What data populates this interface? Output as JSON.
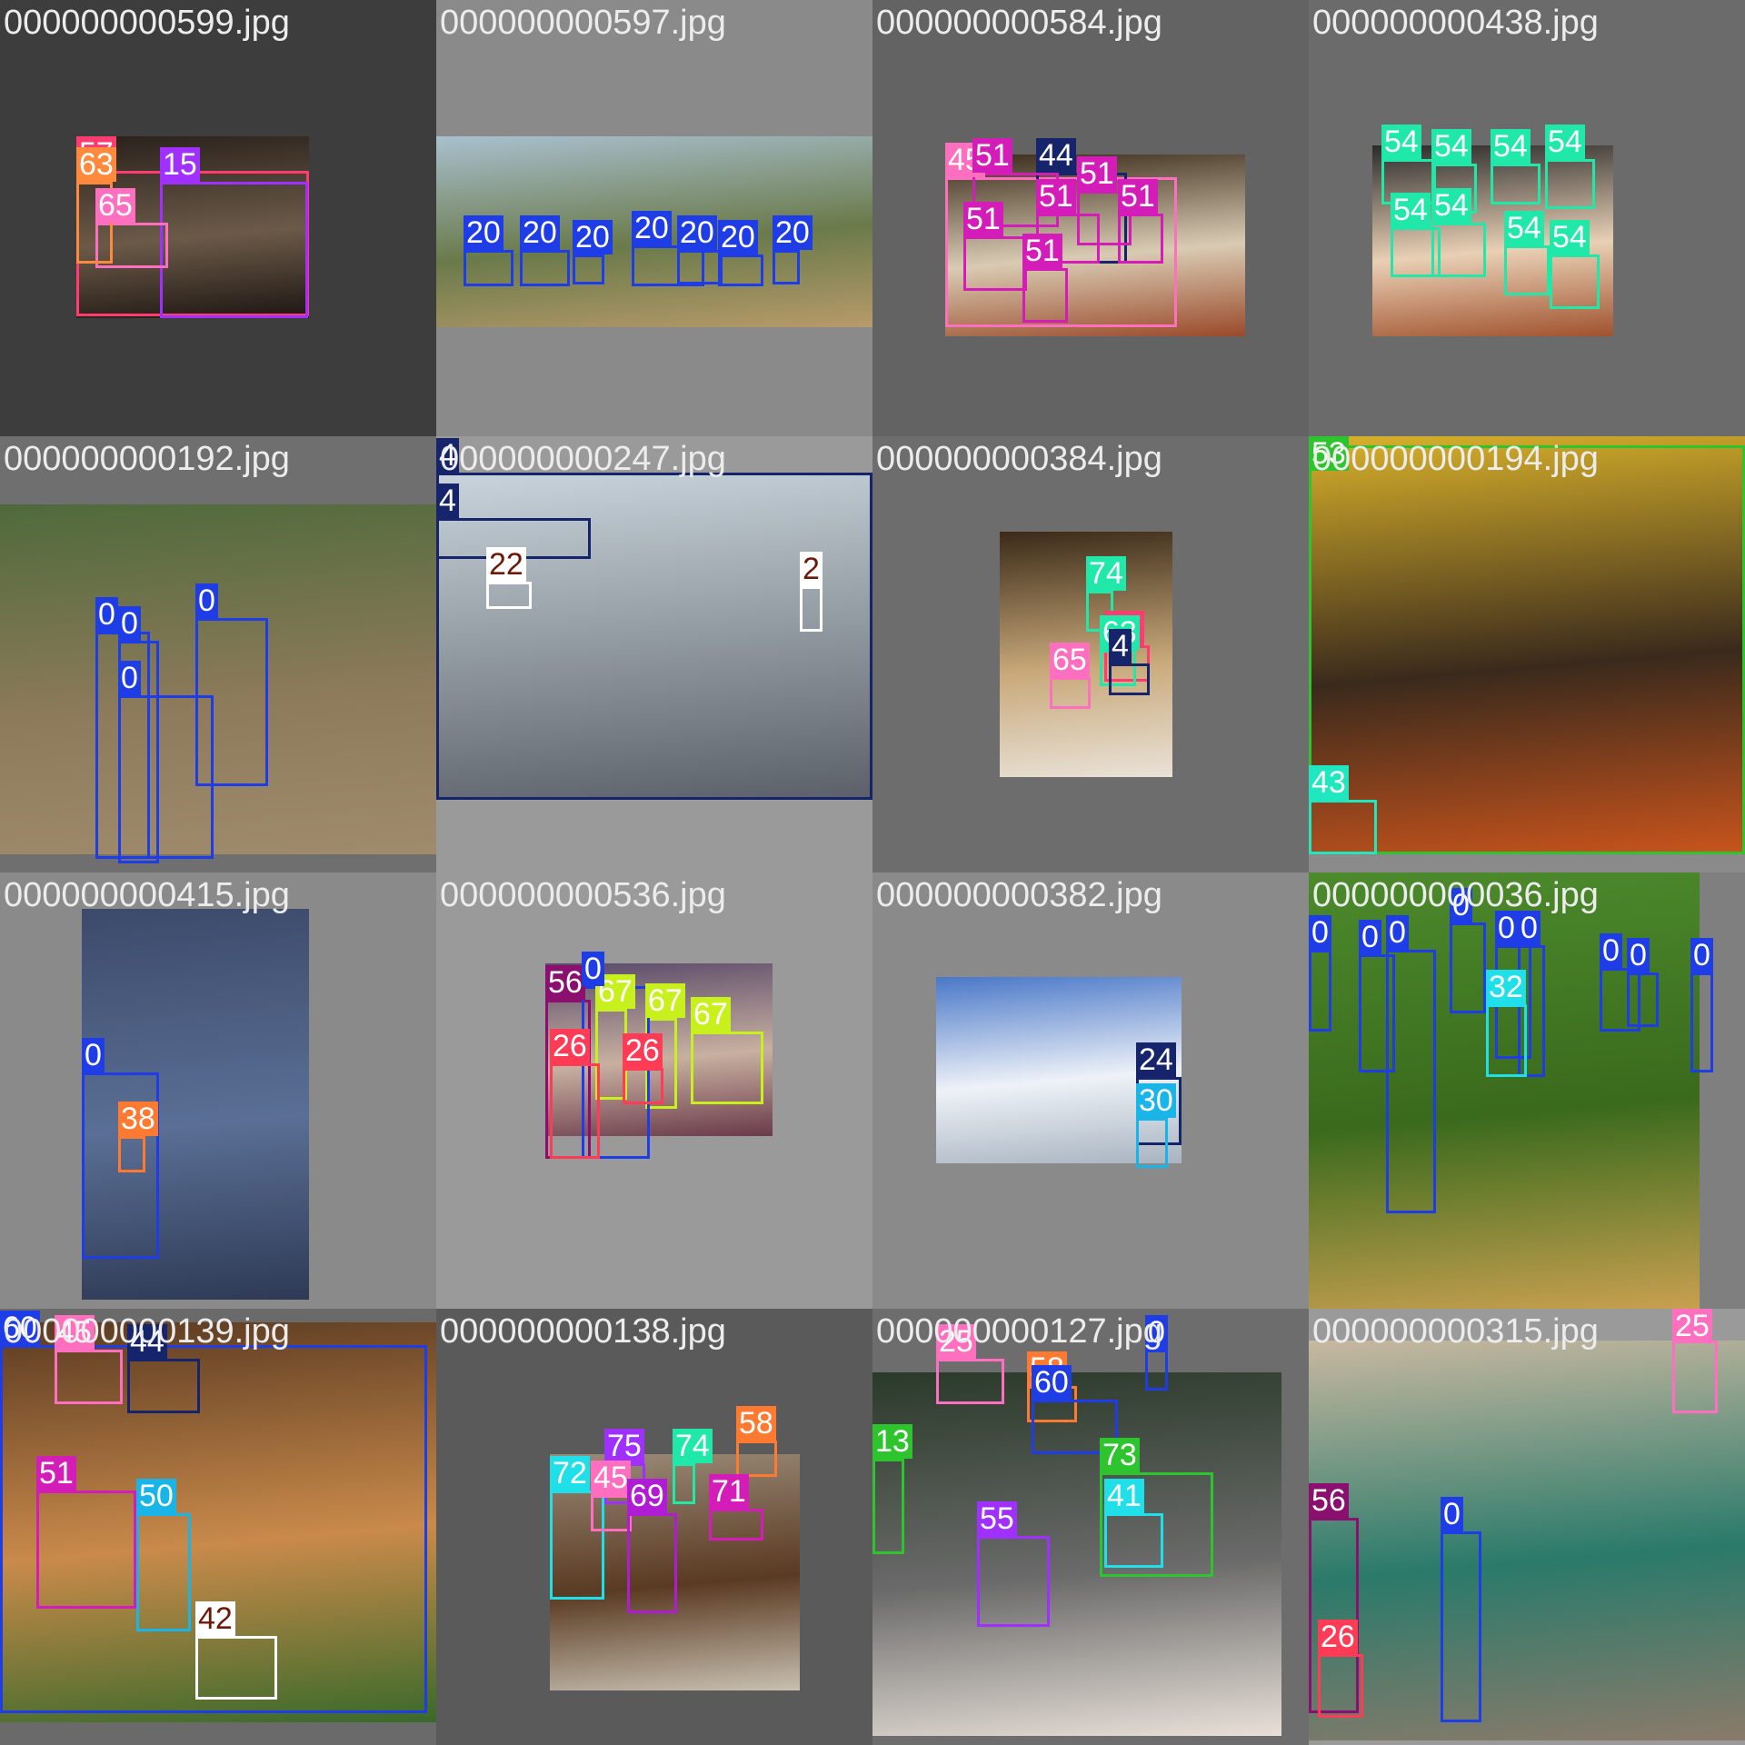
{
  "tiles": [
    {
      "filename": "000000000599.jpg",
      "background": "#3d3d3d",
      "photo_colors": [
        "#2a211c",
        "#6b5a48",
        "#1e1612"
      ],
      "detections": [
        {
          "label": "57",
          "color": "#ff3b70"
        },
        {
          "label": "15",
          "color": "#9f30ff"
        },
        {
          "label": "65",
          "color": "#ff6fbf"
        },
        {
          "label": "63",
          "color": "#ff8a3d"
        }
      ]
    },
    {
      "filename": "000000000597.jpg",
      "background": "#8a8a8a",
      "photo_colors": [
        "#a9c0cf",
        "#6a7a4a",
        "#b89a6a"
      ],
      "detections": [
        {
          "label": "20",
          "color": "#1f3de6"
        },
        {
          "label": "20",
          "color": "#1f3de6"
        },
        {
          "label": "20",
          "color": "#1f3de6"
        },
        {
          "label": "20",
          "color": "#1f3de6"
        },
        {
          "label": "20",
          "color": "#1f3de6"
        },
        {
          "label": "20",
          "color": "#1f3de6"
        },
        {
          "label": "20",
          "color": "#1f3de6"
        }
      ]
    },
    {
      "filename": "000000000584.jpg",
      "background": "#636363",
      "photo_colors": [
        "#3a2a1a",
        "#d9cbb3",
        "#9a4a2a"
      ],
      "detections": [
        {
          "label": "45",
          "color": "#ff6fbf"
        },
        {
          "label": "44",
          "color": "#16246b"
        },
        {
          "label": "51",
          "color": "#d41cb8"
        },
        {
          "label": "51",
          "color": "#d41cb8"
        },
        {
          "label": "51",
          "color": "#d41cb8"
        },
        {
          "label": "51",
          "color": "#d41cb8"
        },
        {
          "label": "51",
          "color": "#d41cb8"
        },
        {
          "label": "51",
          "color": "#d41cb8"
        }
      ]
    },
    {
      "filename": "000000000438.jpg",
      "background": "#6b6b6b",
      "photo_colors": [
        "#2b2b2b",
        "#e9d0b5",
        "#a0522d"
      ],
      "detections": [
        {
          "label": "54",
          "color": "#1fe8a8"
        },
        {
          "label": "54",
          "color": "#1fe8a8"
        },
        {
          "label": "54",
          "color": "#1fe8a8"
        },
        {
          "label": "54",
          "color": "#1fe8a8"
        },
        {
          "label": "54",
          "color": "#1fe8a8"
        },
        {
          "label": "54",
          "color": "#1fe8a8"
        },
        {
          "label": "54",
          "color": "#1fe8a8"
        },
        {
          "label": "54",
          "color": "#1fe8a8"
        }
      ]
    },
    {
      "filename": "000000000192.jpg",
      "background": "#6f6f6f",
      "photo_colors": [
        "#4f6a3c",
        "#8c7a5a",
        "#a08c6c"
      ],
      "detections": [
        {
          "label": "0",
          "color": "#1f3de6"
        },
        {
          "label": "0",
          "color": "#1f3de6"
        },
        {
          "label": "0",
          "color": "#1f3de6"
        },
        {
          "label": "0",
          "color": "#1f3de6"
        }
      ]
    },
    {
      "filename": "000000000247.jpg",
      "background": "#9a9a9a",
      "photo_colors": [
        "#c9d4dc",
        "#8d959c",
        "#5b6068"
      ],
      "detections": [
        {
          "label": "4",
          "color": "#16246b"
        },
        {
          "label": "4",
          "color": "#16246b"
        },
        {
          "label": "22",
          "color": "#ffffff",
          "text_color": "#6b1a0a"
        },
        {
          "label": "2",
          "color": "#ffffff",
          "text_color": "#6b1a0a"
        }
      ]
    },
    {
      "filename": "000000000384.jpg",
      "background": "#6d6d6d",
      "photo_colors": [
        "#3a2a18",
        "#c9a97a",
        "#e9e2d8"
      ],
      "detections": [
        {
          "label": "74",
          "color": "#1fe8a8"
        },
        {
          "label": "57",
          "color": "#ff3b70"
        },
        {
          "label": "63",
          "color": "#1fe8a8"
        },
        {
          "label": "65",
          "color": "#ff6fbf"
        },
        {
          "label": "4",
          "color": "#16246b"
        }
      ]
    },
    {
      "filename": "000000000194.jpg",
      "background": "#8a8a8a",
      "photo_colors": [
        "#d9b22a",
        "#3a2a1c",
        "#c9541c"
      ],
      "detections": [
        {
          "label": "53",
          "color": "#2ec42e"
        },
        {
          "label": "43",
          "color": "#1fe8c0"
        }
      ]
    },
    {
      "filename": "000000000415.jpg",
      "background": "#8a8a8a",
      "photo_colors": [
        "#3c4a6a",
        "#5a6f95",
        "#2e3a55"
      ],
      "detections": [
        {
          "label": "0",
          "color": "#1f3de6"
        },
        {
          "label": "38",
          "color": "#ff7a30"
        }
      ]
    },
    {
      "filename": "000000000536.jpg",
      "background": "#9a9a9a",
      "photo_colors": [
        "#5a4a6a",
        "#c8b0a0",
        "#6a3a4a"
      ],
      "detections": [
        {
          "label": "56",
          "color": "#8b0f6e"
        },
        {
          "label": "67",
          "color": "#c8f01c"
        },
        {
          "label": "67",
          "color": "#c8f01c"
        },
        {
          "label": "0",
          "color": "#1f3de6"
        },
        {
          "label": "26",
          "color": "#ff3b56"
        },
        {
          "label": "26",
          "color": "#ff3b56"
        },
        {
          "label": "67",
          "color": "#c8f01c"
        }
      ]
    },
    {
      "filename": "000000000382.jpg",
      "background": "#8a8a8a",
      "photo_colors": [
        "#4a78c8",
        "#eef2f8",
        "#a8b4c0"
      ],
      "detections": [
        {
          "label": "24",
          "color": "#16246b"
        },
        {
          "label": "30",
          "color": "#19b5e8"
        }
      ]
    },
    {
      "filename": "000000000036.jpg",
      "background": "#7f7f7f",
      "photo_colors": [
        "#4c8a2c",
        "#3a6a1c",
        "#c8a050"
      ],
      "detections": [
        {
          "label": "0",
          "color": "#1f3de6"
        },
        {
          "label": "0",
          "color": "#1f3de6"
        },
        {
          "label": "0",
          "color": "#1f3de6"
        },
        {
          "label": "0",
          "color": "#1f3de6"
        },
        {
          "label": "0",
          "color": "#1f3de6"
        },
        {
          "label": "0",
          "color": "#1f3de6"
        },
        {
          "label": "0",
          "color": "#1f3de6"
        },
        {
          "label": "0",
          "color": "#1f3de6"
        },
        {
          "label": "0",
          "color": "#1f3de6"
        },
        {
          "label": "32",
          "color": "#1fe0e8"
        }
      ]
    },
    {
      "filename": "000000000139.jpg",
      "background": "#6a6a6a",
      "photo_colors": [
        "#5a3a22",
        "#c98a4a",
        "#3a6a2a"
      ],
      "detections": [
        {
          "label": "60",
          "color": "#1f3de6"
        },
        {
          "label": "45",
          "color": "#ff6fbf"
        },
        {
          "label": "44",
          "color": "#16246b"
        },
        {
          "label": "51",
          "color": "#d41cb8"
        },
        {
          "label": "50",
          "color": "#19b5e8"
        },
        {
          "label": "42",
          "color": "#ffffff",
          "text_color": "#6b1a0a"
        }
      ]
    },
    {
      "filename": "000000000138.jpg",
      "background": "#5a5a5a",
      "photo_colors": [
        "#9a8a78",
        "#5a3a22",
        "#c8c0b0"
      ],
      "detections": [
        {
          "label": "72",
          "color": "#1fe0e8"
        },
        {
          "label": "75",
          "color": "#9f30ff"
        },
        {
          "label": "74",
          "color": "#1fe8a8"
        },
        {
          "label": "58",
          "color": "#ff7a30"
        },
        {
          "label": "45",
          "color": "#ff6fbf"
        },
        {
          "label": "69",
          "color": "#b01cd4"
        },
        {
          "label": "71",
          "color": "#d41cb8"
        }
      ]
    },
    {
      "filename": "000000000127.jpg",
      "background": "#6d6d6d",
      "photo_colors": [
        "#2a3a2a",
        "#6a6a6a",
        "#e8e0d8"
      ],
      "detections": [
        {
          "label": "25",
          "color": "#ff6fbf"
        },
        {
          "label": "58",
          "color": "#ff7a30"
        },
        {
          "label": "0",
          "color": "#1f3de6"
        },
        {
          "label": "13",
          "color": "#2ec42e"
        },
        {
          "label": "60",
          "color": "#1f3de6"
        },
        {
          "label": "73",
          "color": "#2ec42e"
        },
        {
          "label": "41",
          "color": "#1fe0e8"
        },
        {
          "label": "55",
          "color": "#9f30ff"
        }
      ]
    },
    {
      "filename": "000000000315.jpg",
      "background": "#9a9a9a",
      "photo_colors": [
        "#c8b8a0",
        "#2a7a6a",
        "#8a7a6a"
      ],
      "detections": [
        {
          "label": "25",
          "color": "#ff6fbf"
        },
        {
          "label": "0",
          "color": "#1f3de6"
        },
        {
          "label": "56",
          "color": "#8b0f6e"
        },
        {
          "label": "26",
          "color": "#ff3b56"
        }
      ]
    }
  ]
}
